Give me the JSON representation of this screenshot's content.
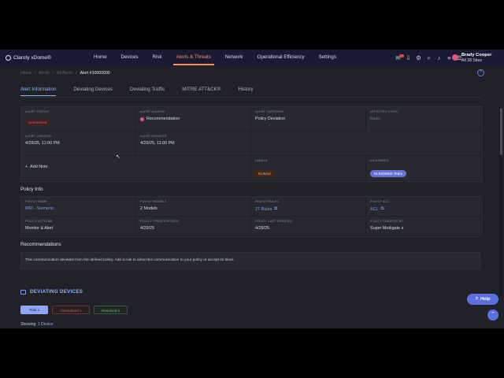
{
  "app": {
    "logo_text": "Claroty xDome®"
  },
  "nav": {
    "items": [
      {
        "label": "Home"
      },
      {
        "label": "Devices"
      },
      {
        "label": "Risk"
      },
      {
        "label": "Alerts & Threats",
        "active": true
      },
      {
        "label": "Network"
      },
      {
        "label": "Operational Efficiency"
      },
      {
        "label": "Settings"
      }
    ]
  },
  "user": {
    "name": "Brady Cooper",
    "sites": "All 28 Sites"
  },
  "breadcrumb": {
    "items": [
      "Home",
      "Alerts",
      "All Alerts"
    ],
    "current": "Alert #10000000"
  },
  "tabs": [
    "Alert Information",
    "Deviating Devices",
    "Deviating Traffic",
    "MITRE ATT&CK®",
    "History"
  ],
  "alert_info": {
    "status_label": "ALERT STATUS",
    "status_value": "Unresolved",
    "source_label": "ALERT SOURCE",
    "source_value": "Recommendation",
    "category_label": "ALERT CATEGORY",
    "category_value": "Policy Deviation",
    "sites_label": "AFFECTED SITES",
    "sites_value": "Basic",
    "created_label": "ALERT CREATED",
    "created_value": "4/29/25, 11:00 PM",
    "updated_label": "ALERT UPDATED",
    "updated_value": "4/29/25, 11:00 PM",
    "add_note": "Add Note",
    "labels_label": "LABELS",
    "labels_value": "BioMed",
    "assignees_label": "ASSIGNEES",
    "assignees_value": "IS BIOMED Team"
  },
  "policy_info": {
    "title": "Policy Info",
    "name_label": "POLICY NAME",
    "name_value": "MRI - Siemens",
    "models_label": "POLICY MODELS",
    "models_value": "2 Models",
    "rules_label": "POLICY RULES",
    "rules_value": "27 Rules",
    "acl_label": "POLICY ACL",
    "acl_value": "ACL",
    "actions_label": "POLICY ACTIONS",
    "actions_value": "Monitor & Alert",
    "creation_label": "POLICY CREATION DATE",
    "creation_value": "4/29/25",
    "last_updated_label": "POLICY LAST UPDATED",
    "last_updated_value": "4/29/25",
    "created_by_label": "POLICY CREATED BY",
    "created_by_value": "Super Medigate s"
  },
  "recommendations": {
    "title": "Recommendations",
    "text": "This communication deviates from the defined policy. Add a rule to allow this communication to your policy or accept its block."
  },
  "deviating_devices": {
    "title": "DEVIATING DEVICES",
    "total": "Total 1",
    "unresolved": "Unresolved 1",
    "resolved": "Resolved 0",
    "showing_prefix": "Showing:",
    "showing_count": "1 Device"
  },
  "help_button": "Help",
  "colors": {
    "accent": "#ff8a5b",
    "primary": "#5c6fe0",
    "link": "#8fb3ff"
  }
}
